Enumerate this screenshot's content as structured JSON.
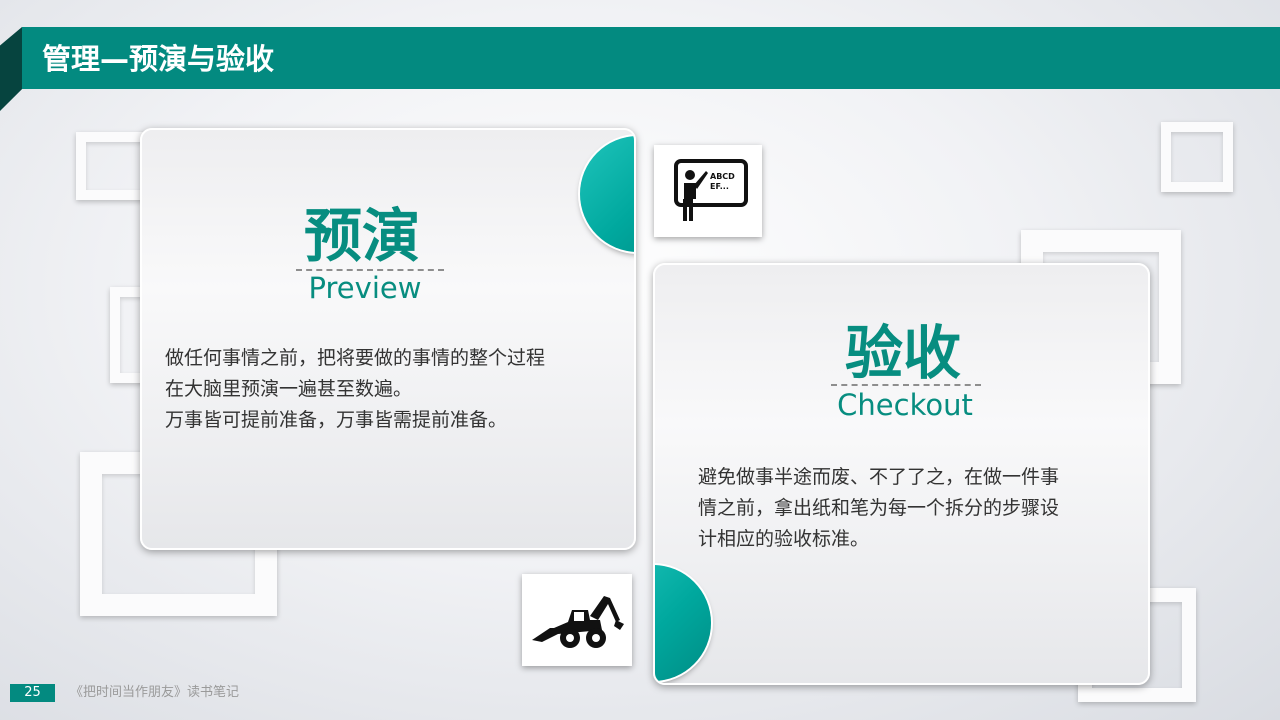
{
  "slide": {
    "title": "管理—预演与验收"
  },
  "cards": {
    "preview": {
      "heading": "预演",
      "subheading": "Preview",
      "lines": [
        "做任何事情之前，把将要做的事情的整个过程",
        "在大脑里预演一遍甚至数遍。",
        "万事皆可提前准备，万事皆需提前准备。"
      ]
    },
    "checkout": {
      "heading": "验收",
      "subheading": "Checkout",
      "lines": [
        "避免做事半途而废、不了了之，在做一件事",
        "情之前，拿出纸和笔为每一个拆分的步骤设",
        "计相应的验收标准。"
      ]
    }
  },
  "icons": {
    "teacher": {
      "name": "teacher-board-icon",
      "board_text_line1": "ABCD",
      "board_text_line2": "EF..."
    },
    "excavator": {
      "name": "backhoe-loader-icon"
    }
  },
  "footer": {
    "page_number": "25",
    "book_title": "《把时间当作朋友》读书笔记"
  },
  "colors": {
    "accent": "#038a80",
    "accent_dark": "#06443f",
    "circle": "#00a89e",
    "heading": "#078d80"
  }
}
